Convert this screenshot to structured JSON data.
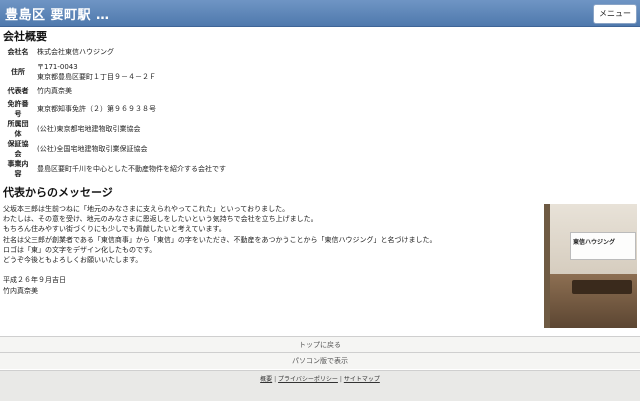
{
  "header": {
    "title": "豊島区 要町駅 …",
    "menu_label": "メニュー"
  },
  "company": {
    "heading": "会社概要",
    "rows": [
      {
        "key": "会社名",
        "value": "株式会社東信ハウジング",
        "value2": ""
      },
      {
        "key": "住所",
        "value": "〒171-0043",
        "value2": "東京都豊島区要町１丁目９－４－２Ｆ"
      },
      {
        "key": "代表者",
        "value": "竹内真奈美",
        "value2": ""
      },
      {
        "key": "免許番号",
        "value": "東京都知事免許（２）第９６９３８号",
        "value2": ""
      },
      {
        "key": "所属団体",
        "value": "(公社)東京都宅地建物取引業協会",
        "value2": ""
      },
      {
        "key": "保証協会",
        "value": "(公社)全国宅地建物取引業保証協会",
        "value2": ""
      },
      {
        "key": "事業内容",
        "value": "豊島区要町千川を中心とした不動産物件を紹介する会社です",
        "value2": ""
      }
    ]
  },
  "message": {
    "heading": "代表からのメッセージ",
    "lines": [
      "父坂本三郎は生前つねに「地元のみなさまに支えられやってこれた」といっておりました。",
      "わたしは、その意を受け、地元のみなさまに恩返しをしたいという気持ちで会社を立ち上げました。",
      "もちろん住みやすい街づくりにも少しでも貢献したいと考えています。",
      "社名は父三郎が創業者である「東信商事」から「東信」の字をいただき、不動産をあつかうことから「東信ハウジング」と名づけました。",
      "ロゴは「東」の文字をデザイン化したものです。",
      "どうぞ今後ともよろしくお願いいたします。",
      "",
      "平成２６年９月吉日",
      "竹内真奈美"
    ],
    "photo_sign": "東信ハウジング"
  },
  "nav": {
    "to_top": "トップに戻る",
    "pc_version": "パソコン版で表示"
  },
  "footer": {
    "links": [
      "概要",
      "プライバシーポリシー",
      "サイトマップ"
    ],
    "separator": "|"
  }
}
